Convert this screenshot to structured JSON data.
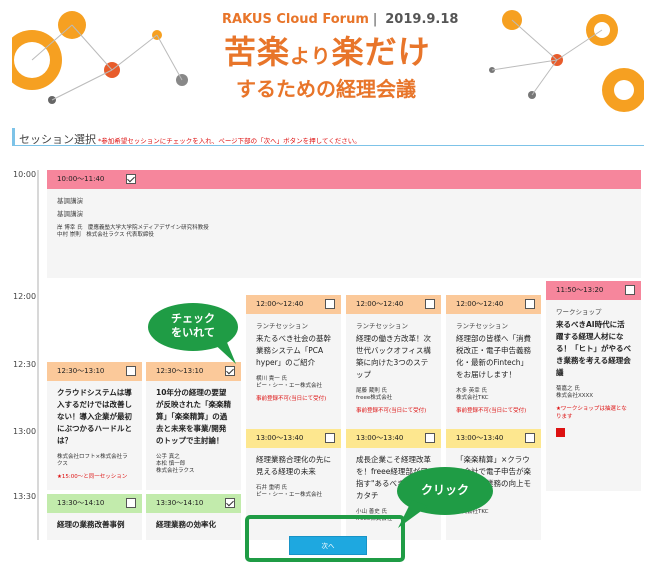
{
  "banner": {
    "brand": "RAKUS Cloud Forum",
    "date": "2019.9.18",
    "title_a": "苦楽",
    "title_b": "より",
    "title_c": "楽だけ",
    "subtitle": "するための経理会議"
  },
  "section": {
    "title": "セッション選択",
    "note": "*参加希望セッションにチェックを入れ、ページ下部の「次へ」ボタンを押してください。"
  },
  "times": [
    "10:00",
    "12:00",
    "12:30",
    "13:00",
    "13:30"
  ],
  "sessions": [
    {
      "time": "10:00～11:40",
      "checked": true,
      "category": "基調講演",
      "title": "基調講演",
      "speakers": [
        "岸 博幸 氏　慶應義塾大学大学院メディアデザイン研究科教授",
        "中村 崇則　株式会社ラクス 代表取締役"
      ],
      "warning": ""
    },
    {
      "time": "12:00～12:40",
      "checked": false,
      "category": "ランチセッション",
      "title": "来たるべき社会の基幹業務システム「PCA hyper」のご紹介",
      "speakers": [
        "横川 貴一 氏",
        "ピー・シー・エー株式会社"
      ],
      "warning": "事前登録不可(当日にて受付)"
    },
    {
      "time": "12:00～12:40",
      "checked": false,
      "category": "ランチセッション",
      "title": "経理の働き方改革！次世代バックオフィス構築に向けた3つのステップ",
      "speakers": [
        "尾藤 蔵則 氏",
        "freee株式会社"
      ],
      "warning": "事前登録不可(当日にて受付)"
    },
    {
      "time": "12:00～12:40",
      "checked": false,
      "category": "ランチセッション",
      "title": "経理部の皆様へ「消費税改正・電子申告義務化・最新のFintech」をお届けします！",
      "speakers": [
        "木多 英幸 氏",
        "株式会社TKC"
      ],
      "warning": "事前登録不可(当日にて受付)"
    },
    {
      "time": "11:50～13:20",
      "checked": false,
      "category": "ワークショップ",
      "title": "来るべきAI時代に活躍する経理人材になる！「ヒト」がやるべき業務を考える経理会議",
      "speakers": [
        "菊嘉之 氏",
        "株式会社XXXX"
      ],
      "warning": "★ワークショップは抽選となります"
    },
    {
      "time": "12:30～13:10",
      "checked": false,
      "category": "",
      "title": "クラウドシステムは導入するだけでは改善しない！導入企業が最初にぶつかるハードルとは？",
      "speakers": [
        "株式会社ロフト×株式会社ラクス"
      ],
      "warning": "★15:00～と同一セッション"
    },
    {
      "time": "12:30～13:10",
      "checked": true,
      "category": "",
      "title": "10年分の経理の要望が反映された「楽楽精算」「楽楽精算」の過去と未来を事業/開発のトップで主討論！",
      "speakers": [
        "公手 真之",
        "本松 慎一郎",
        "株式会社ラクス"
      ],
      "warning": ""
    },
    {
      "time": "13:00～13:40",
      "checked": false,
      "category": "",
      "title": "経理業務合理化の先に見える経理の未来",
      "speakers": [
        "石井 重明 氏",
        "ピー・シー・エー株式会社"
      ],
      "warning": ""
    },
    {
      "time": "13:00～13:40",
      "checked": false,
      "category": "",
      "title": "成長企業こそ経理改革を！freee経理部が目指す\"あるべき\"経理のカタチ",
      "speakers": [
        "小山 善史 氏",
        "freee株式会社"
      ],
      "warning": ""
    },
    {
      "time": "13:00～13:40",
      "checked": false,
      "category": "",
      "title": "「楽楽精算」×クラウド会計で電子申告が楽に！決算業務の向上モデル",
      "speakers": [
        "株式会社TKC"
      ],
      "warning": ""
    },
    {
      "time": "13:30～14:10",
      "checked": false,
      "category": "",
      "title": "経理の業務改善事例",
      "speakers": [],
      "warning": ""
    },
    {
      "time": "13:30～14:10",
      "checked": true,
      "category": "",
      "title": "経理業務の効率化",
      "speakers": [],
      "warning": ""
    }
  ],
  "callouts": {
    "check": [
      "チェック",
      "をいれて"
    ],
    "click": "クリック"
  },
  "next_button": "次へ",
  "colors": {
    "pink": "#f6869c",
    "orange": "#fbc99a",
    "yellow": "#fde78f",
    "green": "#c2ebac",
    "callout": "#1f9c45",
    "button": "#1ea8e0"
  }
}
